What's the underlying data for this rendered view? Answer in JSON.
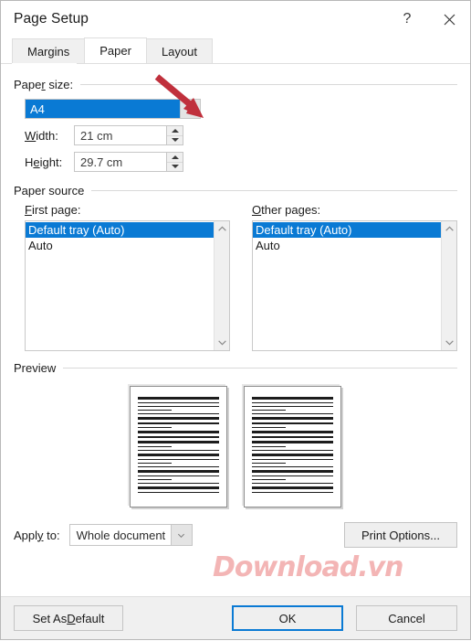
{
  "window": {
    "title": "Page Setup",
    "help_icon": "question-mark-icon",
    "close_icon": "close-icon"
  },
  "tabs": [
    {
      "label": "Margins",
      "active": false
    },
    {
      "label": "Paper",
      "active": true
    },
    {
      "label": "Layout",
      "active": false
    }
  ],
  "paper_size": {
    "group_title": "Paper size:",
    "value": "A4",
    "dropdown_icon": "chevron-down-icon",
    "width": {
      "label_pre": "W",
      "label_key": "",
      "label_post": "idth:",
      "value": "21 cm"
    },
    "height": {
      "label_pre": "H",
      "label_key": "e",
      "label_post": "ight:",
      "value": "29.7 cm"
    },
    "width_label": "Width:",
    "height_label": "Height:",
    "width_value": "21 cm",
    "height_value": "29.7 cm",
    "spinner_up_icon": "triangle-up-icon",
    "spinner_down_icon": "triangle-down-icon"
  },
  "paper_source": {
    "group_title": "Paper source",
    "first_page": {
      "label": "First page:",
      "items": [
        "Default tray (Auto)",
        "Auto"
      ],
      "selected": "Default tray (Auto)"
    },
    "other_pages": {
      "label": "Other pages:",
      "items": [
        "Default tray (Auto)",
        "Auto"
      ],
      "selected": "Default tray (Auto)"
    },
    "scroll_up_icon": "chevron-up-icon",
    "scroll_down_icon": "chevron-down-icon"
  },
  "preview": {
    "group_title": "Preview",
    "pages": 2
  },
  "apply": {
    "label": "Apply to:",
    "value": "Whole document",
    "dropdown_icon": "chevron-down-icon",
    "print_options_label": "Print Options..."
  },
  "footer": {
    "set_as_default": "Set As Default",
    "ok": "OK",
    "cancel": "Cancel"
  },
  "annotation": {
    "arrow_color": "#c0303c",
    "arrow_target": "paper-size-dropdown-button"
  },
  "watermark": {
    "text": "Download.vn",
    "color": "#f2a9a9"
  },
  "colors": {
    "selection_blue": "#0a7ad4",
    "focus_blue": "#0a7ad4",
    "dialog_bg": "#ffffff",
    "footer_bg": "#f0f0f0",
    "button_bg": "#efefef"
  }
}
